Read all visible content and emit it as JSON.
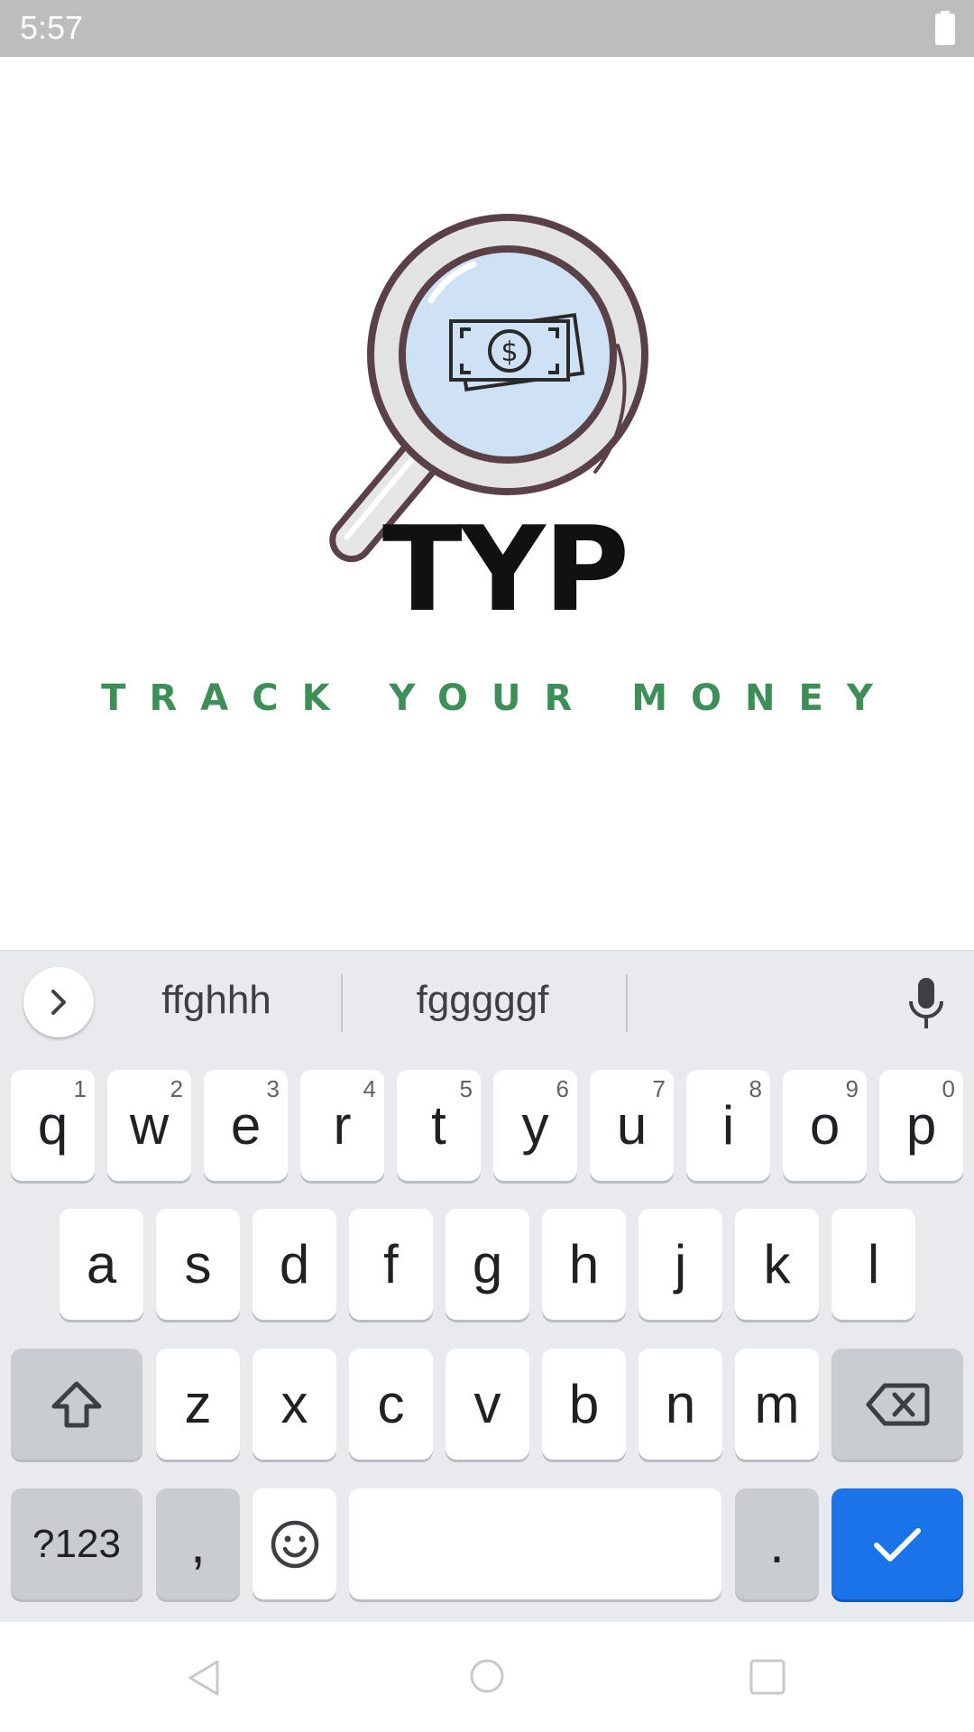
{
  "status_bar": {
    "time": "5:57",
    "battery_icon": "battery-full-icon"
  },
  "splash": {
    "logo_icon": "magnifier-money-icon",
    "title": "TYP",
    "tagline": "TRACK YOUR MONEY",
    "colors": {
      "title": "#111111",
      "tagline": "#3e8e58",
      "lens": "#cfe1f4",
      "frame": "#5a4148"
    }
  },
  "keyboard": {
    "suggestions": [
      "ffghhh",
      "fgggggf"
    ],
    "expand_icon": "chevron-right-icon",
    "mic_icon": "microphone-icon",
    "row1": [
      {
        "label": "q",
        "hint": "1"
      },
      {
        "label": "w",
        "hint": "2"
      },
      {
        "label": "e",
        "hint": "3"
      },
      {
        "label": "r",
        "hint": "4"
      },
      {
        "label": "t",
        "hint": "5"
      },
      {
        "label": "y",
        "hint": "6"
      },
      {
        "label": "u",
        "hint": "7"
      },
      {
        "label": "i",
        "hint": "8"
      },
      {
        "label": "o",
        "hint": "9"
      },
      {
        "label": "p",
        "hint": "0"
      }
    ],
    "row2": [
      "a",
      "s",
      "d",
      "f",
      "g",
      "h",
      "j",
      "k",
      "l"
    ],
    "row3": [
      "z",
      "x",
      "c",
      "v",
      "b",
      "n",
      "m"
    ],
    "shift_icon": "shift-icon",
    "backspace_icon": "backspace-icon",
    "symbols_label": "?123",
    "comma_label": ",",
    "emoji_icon": "emoji-icon",
    "period_label": ".",
    "enter_icon": "checkmark-icon",
    "accent_color": "#1a73e8"
  },
  "nav_bar": {
    "back_icon": "back-triangle-icon",
    "home_icon": "home-circle-icon",
    "recents_icon": "recents-square-icon"
  }
}
